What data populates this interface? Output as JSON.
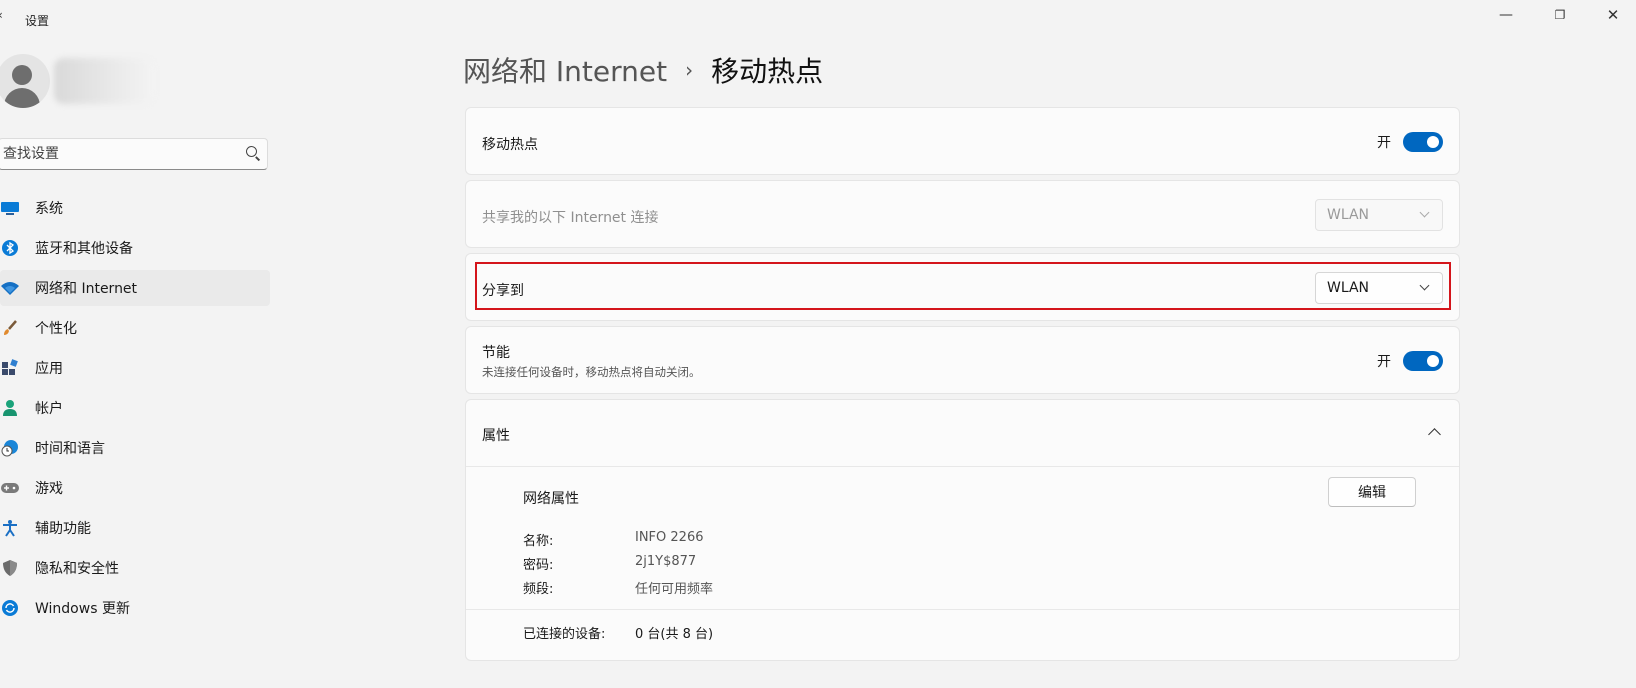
{
  "window": {
    "back_glyph": "‹",
    "title": "设置",
    "min_glyph": "—",
    "max_glyph": "❐",
    "close_glyph": "✕"
  },
  "search": {
    "placeholder": "查找设置"
  },
  "sidebar": {
    "items": [
      {
        "label": "系统",
        "icon": "monitor-icon",
        "color": "#0078d4"
      },
      {
        "label": "蓝牙和其他设备",
        "icon": "bluetooth-icon",
        "color": "#0078d4"
      },
      {
        "label": "网络和 Internet",
        "icon": "wifi-icon",
        "color": "#1570c4",
        "active": true
      },
      {
        "label": "个性化",
        "icon": "brush-icon",
        "color": "#e08a2e"
      },
      {
        "label": "应用",
        "icon": "apps-icon",
        "color": "#3a4a6b"
      },
      {
        "label": "帐户",
        "icon": "account-icon",
        "color": "#1aa37a"
      },
      {
        "label": "时间和语言",
        "icon": "globe-clock-icon",
        "color": "#1a86d8"
      },
      {
        "label": "游戏",
        "icon": "gamepad-icon",
        "color": "#707070"
      },
      {
        "label": "辅助功能",
        "icon": "accessibility-icon",
        "color": "#1a6fc4"
      },
      {
        "label": "隐私和安全性",
        "icon": "shield-icon",
        "color": "#6b6b6b"
      },
      {
        "label": "Windows 更新",
        "icon": "update-icon",
        "color": "#0078d4"
      }
    ]
  },
  "breadcrumb": {
    "parent": "网络和 Internet",
    "separator": "›",
    "current": "移动热点"
  },
  "hotspot": {
    "label": "移动热点",
    "state": "开",
    "on": true
  },
  "share_from": {
    "label": "共享我的以下 Internet 连接",
    "value": "WLAN",
    "disabled": true
  },
  "share_to": {
    "label": "分享到",
    "value": "WLAN"
  },
  "power_saving": {
    "label": "节能",
    "description": "未连接任何设备时，移动热点将自动关闭。",
    "state": "开",
    "on": true
  },
  "properties": {
    "label": "属性",
    "section_title": "网络属性",
    "edit_label": "编辑",
    "rows": [
      {
        "key": "名称:",
        "value": "INFO 2266"
      },
      {
        "key": "密码:",
        "value": "2j1Y$877"
      },
      {
        "key": "频段:",
        "value": "任何可用频率"
      }
    ],
    "connected": {
      "key": "已连接的设备:",
      "value": "0 台(共 8 台)"
    }
  },
  "colors": {
    "accent": "#0067c0",
    "highlight_border": "#d4151b"
  }
}
